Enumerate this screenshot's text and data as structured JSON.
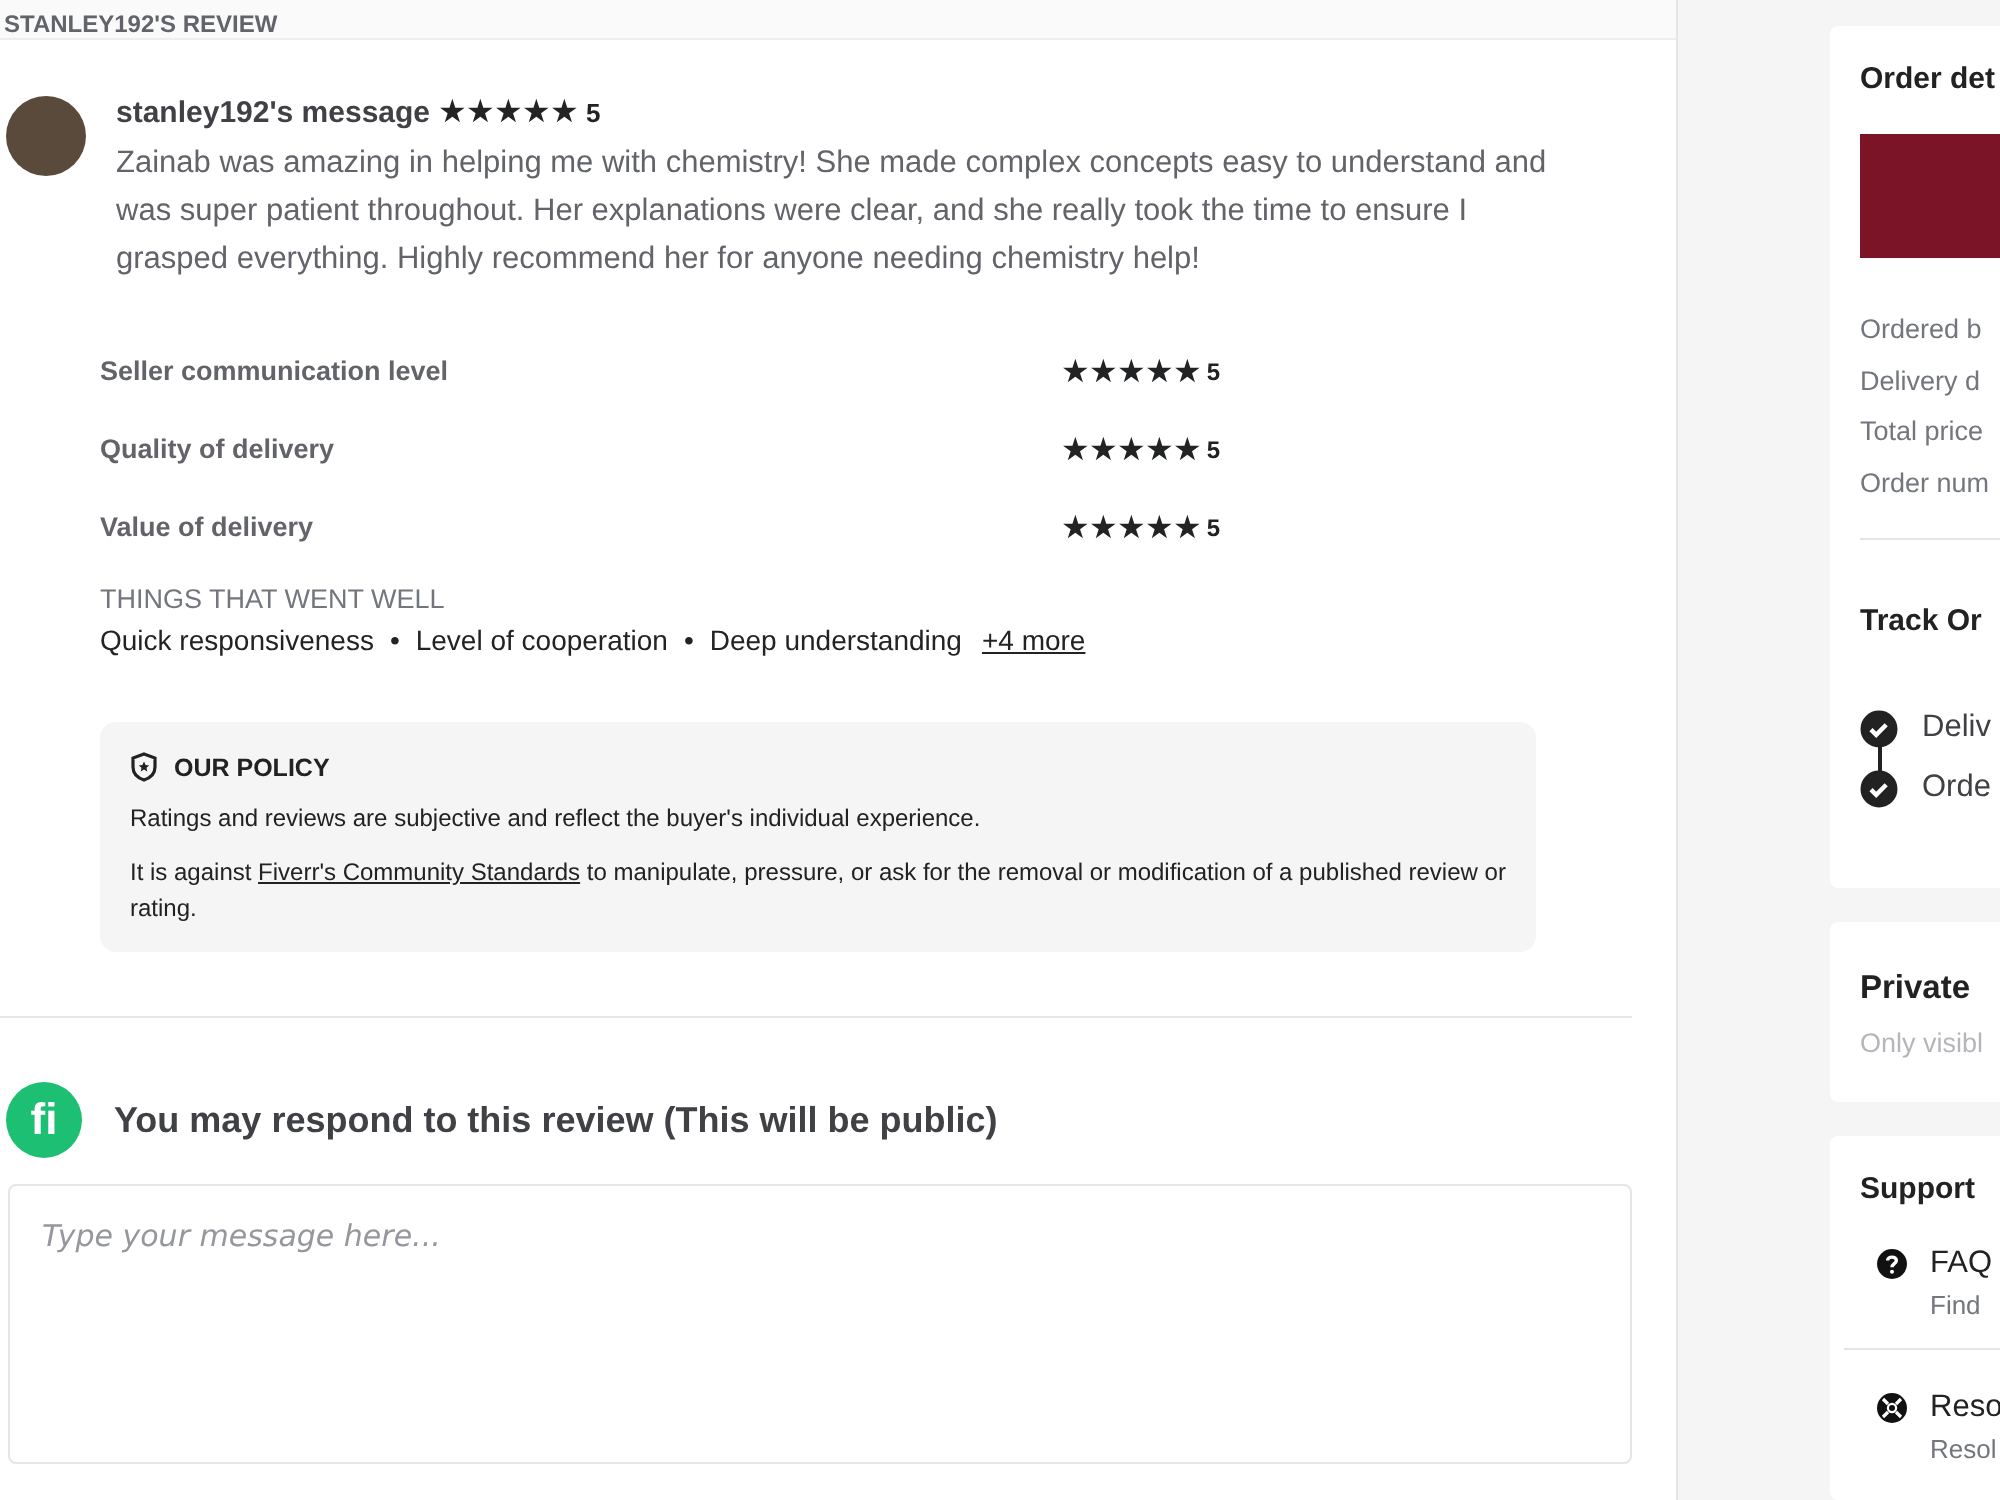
{
  "header": {
    "title": "STANLEY192'S REVIEW"
  },
  "review": {
    "author_message": "stanley192's message",
    "stars": 5,
    "score": "5",
    "text": "Zainab was amazing in helping me with chemistry! She made complex concepts easy to understand and was super patient throughout. Her explanations were clear, and she really took the time to ensure I grasped everything. Highly recommend her for anyone needing chemistry help!"
  },
  "ratings": [
    {
      "label": "Seller communication level",
      "stars": 5,
      "score": "5"
    },
    {
      "label": "Quality of delivery",
      "stars": 5,
      "score": "5"
    },
    {
      "label": "Value of delivery",
      "stars": 5,
      "score": "5"
    }
  ],
  "things_went_well": {
    "title": "THINGS THAT WENT WELL",
    "items": [
      "Quick responsiveness",
      "Level of cooperation",
      "Deep understanding"
    ],
    "separator": "•",
    "more": "+4 more"
  },
  "policy": {
    "title": "OUR POLICY",
    "text_1": "Ratings and reviews are subjective and reflect the buyer's individual experience.",
    "text_2_before": "It is against",
    "link": "Fiverr's Community Standards",
    "text_2_after": "to manipulate, pressure, or ask for the removal or modification of a published review or rating."
  },
  "respond": {
    "title": "You may respond to this review (This will be public)",
    "logo": "fi",
    "placeholder": "Type your message here..."
  },
  "order_details": {
    "title": "Order det",
    "fields": [
      "Ordered b",
      "Delivery d",
      "Total price",
      "Order num"
    ]
  },
  "track_order": {
    "title": "Track Or",
    "steps": [
      {
        "label": "Deliv",
        "checked": true
      },
      {
        "label": "Orde",
        "checked": true
      }
    ]
  },
  "private_note": {
    "title": "Private",
    "subtitle": "Only visibl"
  },
  "support": {
    "title": "Support",
    "items": [
      {
        "kind": "faq",
        "title": "FAQ",
        "subtitle": "Find"
      },
      {
        "kind": "resolution",
        "title": "Reso",
        "subtitle": "Resol"
      }
    ]
  }
}
